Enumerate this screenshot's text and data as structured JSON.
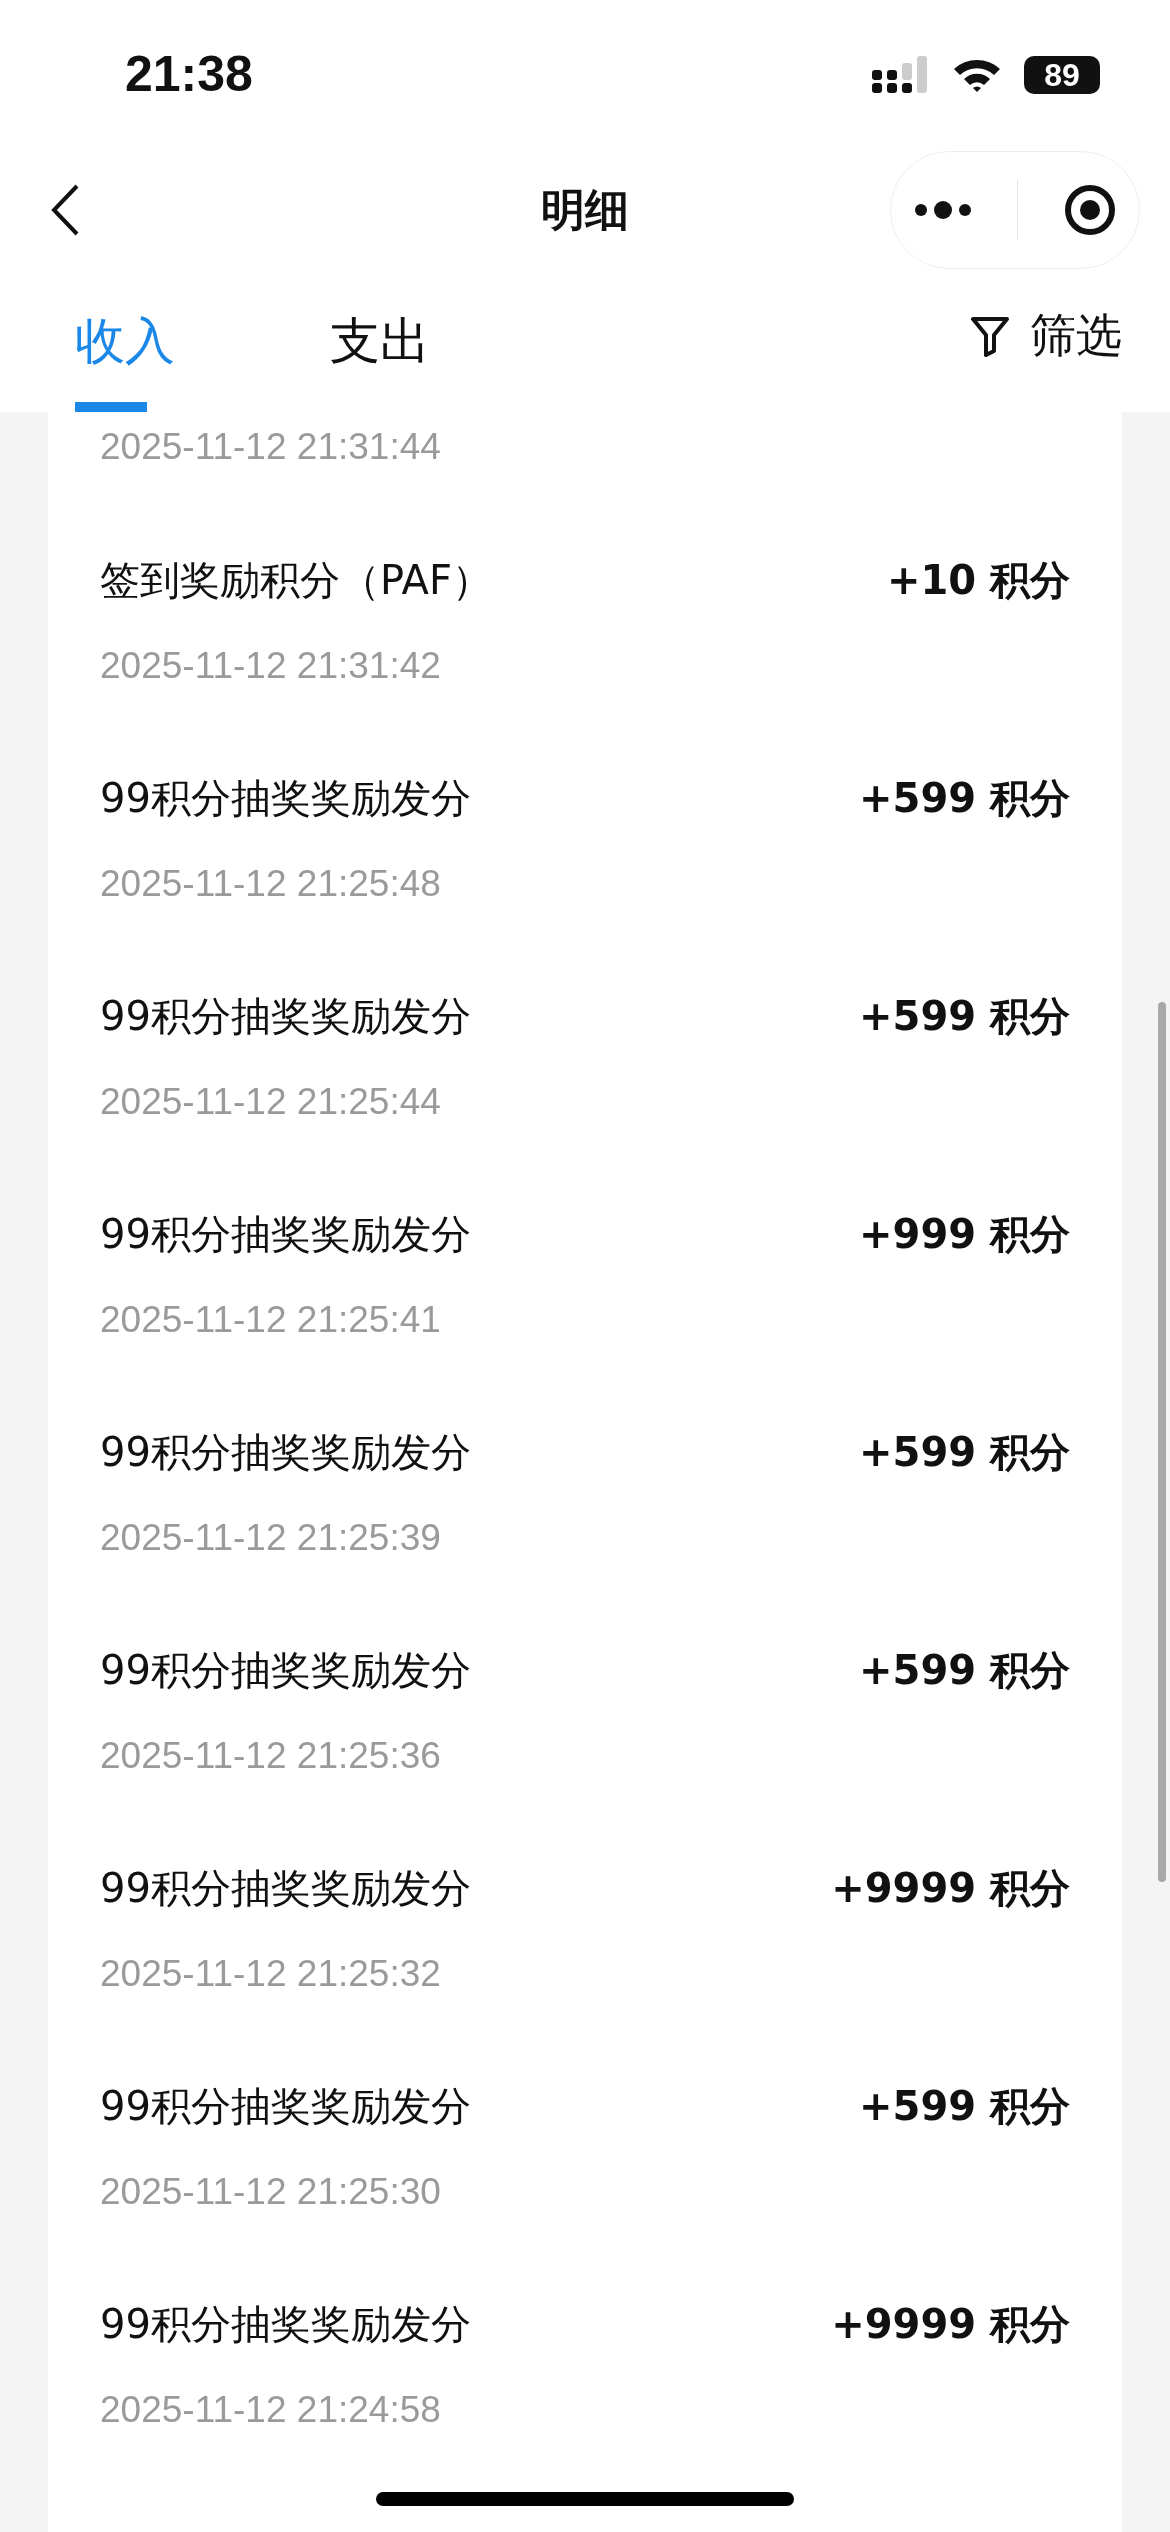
{
  "status_bar": {
    "time": "21:38",
    "battery": "89"
  },
  "nav": {
    "title": "明细"
  },
  "tabs": [
    {
      "label": "收入",
      "selected": true
    },
    {
      "label": "支出",
      "selected": false
    }
  ],
  "filter": {
    "label": "筛选"
  },
  "partial_row": {
    "time": "2025-11-12 21:31:44"
  },
  "records": [
    {
      "title": "签到奖励积分（PAF）",
      "time": "2025-11-12 21:31:42",
      "amount": "+10 积分"
    },
    {
      "title": "99积分抽奖奖励发分",
      "time": "2025-11-12 21:25:48",
      "amount": "+599 积分"
    },
    {
      "title": "99积分抽奖奖励发分",
      "time": "2025-11-12 21:25:44",
      "amount": "+599 积分"
    },
    {
      "title": "99积分抽奖奖励发分",
      "time": "2025-11-12 21:25:41",
      "amount": "+999 积分"
    },
    {
      "title": "99积分抽奖奖励发分",
      "time": "2025-11-12 21:25:39",
      "amount": "+599 积分"
    },
    {
      "title": "99积分抽奖奖励发分",
      "time": "2025-11-12 21:25:36",
      "amount": "+599 积分"
    },
    {
      "title": "99积分抽奖奖励发分",
      "time": "2025-11-12 21:25:32",
      "amount": "+9999 积分"
    },
    {
      "title": "99积分抽奖奖励发分",
      "time": "2025-11-12 21:25:30",
      "amount": "+599 积分"
    },
    {
      "title": "99积分抽奖奖励发分",
      "time": "2025-11-12 21:24:58",
      "amount": "+9999 积分"
    }
  ]
}
